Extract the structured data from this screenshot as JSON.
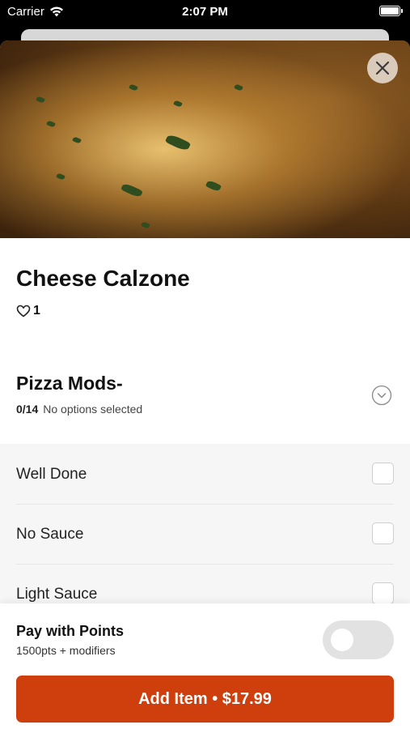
{
  "status_bar": {
    "carrier": "Carrier",
    "time": "2:07 PM"
  },
  "item": {
    "name": "Cheese Calzone",
    "likes": "1"
  },
  "modifier_group": {
    "title": "Pizza Mods-",
    "count": "0/14",
    "status": "No options selected",
    "options": [
      {
        "label": "Well Done"
      },
      {
        "label": "No Sauce"
      },
      {
        "label": "Light Sauce"
      }
    ]
  },
  "footer": {
    "points_title": "Pay with Points",
    "points_sub": "1500pts + modifiers",
    "add_button": "Add Item • $17.99"
  },
  "colors": {
    "accent": "#cf3f0d",
    "toggle_off": "#e2e2e2"
  },
  "icons": [
    "wifi-icon",
    "battery-icon",
    "close-icon",
    "heart-icon",
    "chevron-down-icon"
  ]
}
